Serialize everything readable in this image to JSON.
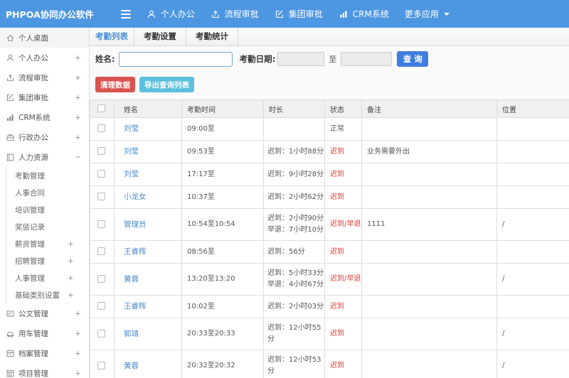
{
  "navbar": {
    "logo": "PHPOA协同办公软件",
    "items": [
      {
        "key": "personal-office",
        "icon": "user",
        "label": "个人办公"
      },
      {
        "key": "workflow-approval",
        "icon": "share",
        "label": "流程审批"
      },
      {
        "key": "group-approval",
        "icon": "edit",
        "label": "集团审批"
      },
      {
        "key": "crm-system",
        "icon": "chart",
        "label": "CRM系统"
      },
      {
        "key": "more-apps",
        "icon": "",
        "label": "更多应用",
        "caret": true
      }
    ]
  },
  "sidebar": {
    "items": [
      {
        "key": "personal-desktop",
        "icon": "home",
        "label": "个人桌面",
        "active": true
      },
      {
        "key": "personal-office",
        "icon": "user",
        "label": "个人办公",
        "expand": "+"
      },
      {
        "key": "workflow-approval",
        "icon": "share",
        "label": "流程审批",
        "expand": "+"
      },
      {
        "key": "group-approval",
        "icon": "edit",
        "label": "集团审批",
        "expand": "+"
      },
      {
        "key": "crm-system",
        "icon": "chart",
        "label": "CRM系统",
        "expand": "+"
      },
      {
        "key": "admin-office",
        "icon": "briefcase",
        "label": "行政办公",
        "expand": "+"
      },
      {
        "key": "human-resources",
        "icon": "book",
        "label": "人力资源",
        "expand": "−",
        "children": [
          {
            "key": "attendance-mgmt",
            "label": "考勤管理"
          },
          {
            "key": "hr-contract",
            "label": "人事合同"
          },
          {
            "key": "training-mgmt",
            "label": "培训管理"
          },
          {
            "key": "reward-punishment",
            "label": "奖惩记录"
          },
          {
            "key": "salary-mgmt",
            "label": "薪资管理",
            "expand": "+"
          },
          {
            "key": "recruit-mgmt",
            "label": "招聘管理",
            "expand": "+"
          },
          {
            "key": "personnel-mgmt",
            "label": "人事管理",
            "expand": "+"
          },
          {
            "key": "base-category-settings",
            "label": "基础类别设置",
            "expand": "+"
          }
        ]
      },
      {
        "key": "document-mgmt",
        "icon": "doc",
        "label": "公文管理",
        "expand": "+"
      },
      {
        "key": "vehicle-mgmt",
        "icon": "car",
        "label": "用车管理",
        "expand": "+"
      },
      {
        "key": "archive-mgmt",
        "icon": "archive",
        "label": "档案管理",
        "expand": "+"
      },
      {
        "key": "project-mgmt",
        "icon": "calendar",
        "label": "项目管理",
        "expand": "+"
      }
    ]
  },
  "tabs": [
    {
      "key": "attendance-list",
      "label": "考勤列表",
      "active": true
    },
    {
      "key": "attendance-settings",
      "label": "考勤设置",
      "active": false
    },
    {
      "key": "attendance-stats",
      "label": "考勤统计",
      "active": false
    }
  ],
  "filter": {
    "name_label": "姓名:",
    "name_value": "",
    "date_label": "考勤日期:",
    "date_from": "",
    "to_label": "至",
    "date_to": "",
    "search_button": "查 询"
  },
  "actions": {
    "clean_button": "清理数据",
    "export_button": "导出查询列表"
  },
  "colors": {
    "navbar_blue": "#4d96e2",
    "search_blue": "#3f7de0",
    "danger_red": "#d9534f",
    "info_cyan": "#5bc0de",
    "link_blue": "#4a8bc8",
    "late_red": "#dd3b35"
  },
  "table": {
    "columns": [
      "姓名",
      "考勤时间",
      "时长",
      "状态",
      "备注",
      "位置"
    ],
    "rows": [
      {
        "name": "刘莹",
        "time": "09:00至",
        "duration": [],
        "status": "正常",
        "status_type": "normal",
        "remark": "",
        "location": ""
      },
      {
        "name": "刘莹",
        "time": "09:53至",
        "duration": [
          "迟到：1小时88分"
        ],
        "status": "迟到",
        "status_type": "late",
        "remark": "业务需要外出",
        "location": ""
      },
      {
        "name": "刘莹",
        "time": "17:17至",
        "duration": [
          "迟到：9小时28分"
        ],
        "status": "迟到",
        "status_type": "late",
        "remark": "",
        "location": ""
      },
      {
        "name": "小龙女",
        "time": "10:37至",
        "duration": [
          "迟到：2小时62分"
        ],
        "status": "迟到",
        "status_type": "late",
        "remark": "",
        "location": ""
      },
      {
        "name": "管理员",
        "time": "10:54至10:54",
        "duration": [
          "迟到：2小时90分",
          "早退：7小时10分"
        ],
        "status": "迟到/早退",
        "status_type": "late",
        "remark": "1111",
        "location": "/"
      },
      {
        "name": "王睿辉",
        "time": "08:56至",
        "duration": [
          "迟到：56分"
        ],
        "status": "迟到",
        "status_type": "late",
        "remark": "",
        "location": ""
      },
      {
        "name": "黄蓉",
        "time": "13:20至13:20",
        "duration": [
          "迟到：5小时33分",
          "早退：4小时67分"
        ],
        "status": "迟到/早退",
        "status_type": "late",
        "remark": "",
        "location": "/"
      },
      {
        "name": "王睿辉",
        "time": "10:02至",
        "duration": [
          "迟到：2小时03分"
        ],
        "status": "迟到",
        "status_type": "late",
        "remark": "",
        "location": ""
      },
      {
        "name": "郭靖",
        "time": "20:33至20:33",
        "duration": [
          "迟到：12小时55分"
        ],
        "status": "迟到",
        "status_type": "late",
        "remark": "",
        "location": "/"
      },
      {
        "name": "黄蓉",
        "time": "20:32至20:32",
        "duration": [
          "迟到：12小时53分"
        ],
        "status": "迟到",
        "status_type": "late",
        "remark": "",
        "location": "/"
      }
    ]
  }
}
